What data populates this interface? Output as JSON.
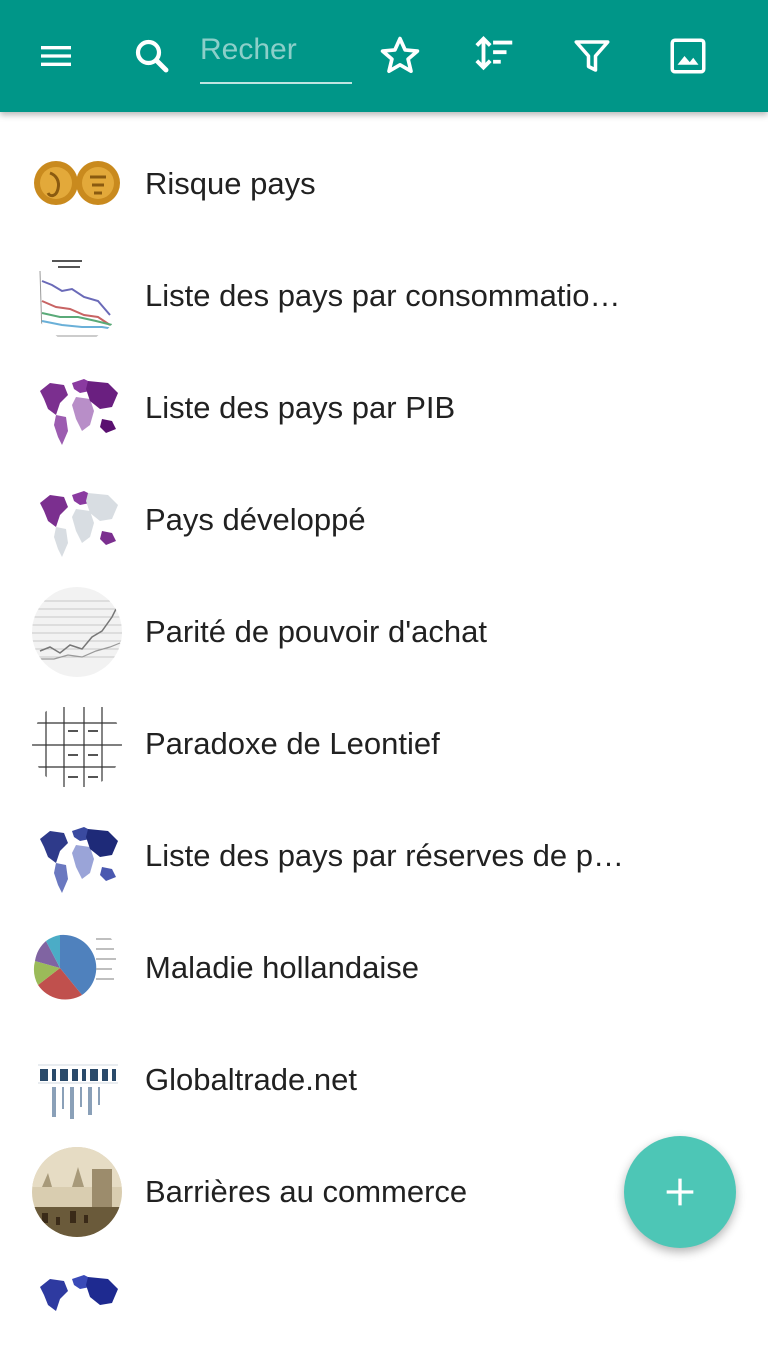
{
  "toolbar": {
    "search_placeholder": "Recher",
    "search_value": "",
    "icons": [
      "menu-icon",
      "search-icon",
      "star-outline-icon",
      "sort-icon",
      "filter-icon",
      "image-icon"
    ],
    "color": "#009688"
  },
  "articles": [
    {
      "title": "Risque pays",
      "thumb": "gold-coins"
    },
    {
      "title": "Liste des pays par consommatio…",
      "thumb": "line-chart"
    },
    {
      "title": "Liste des pays par PIB",
      "thumb": "world-map-purple"
    },
    {
      "title": "Pays développé",
      "thumb": "world-map-purple-sparse"
    },
    {
      "title": "Parité de pouvoir d'achat",
      "thumb": "line-chart-grey"
    },
    {
      "title": "Paradoxe de Leontief",
      "thumb": "table"
    },
    {
      "title": "Liste des pays par réserves de p…",
      "thumb": "world-map-blue"
    },
    {
      "title": "Maladie hollandaise",
      "thumb": "pie-chart"
    },
    {
      "title": "Globaltrade.net",
      "thumb": "globaltrade-logo"
    },
    {
      "title": "Barrières au commerce",
      "thumb": "painting"
    },
    {
      "title": "",
      "thumb": "world-map-blue"
    }
  ],
  "fab": {
    "icon": "plus-icon",
    "color": "#4dc6b6"
  }
}
